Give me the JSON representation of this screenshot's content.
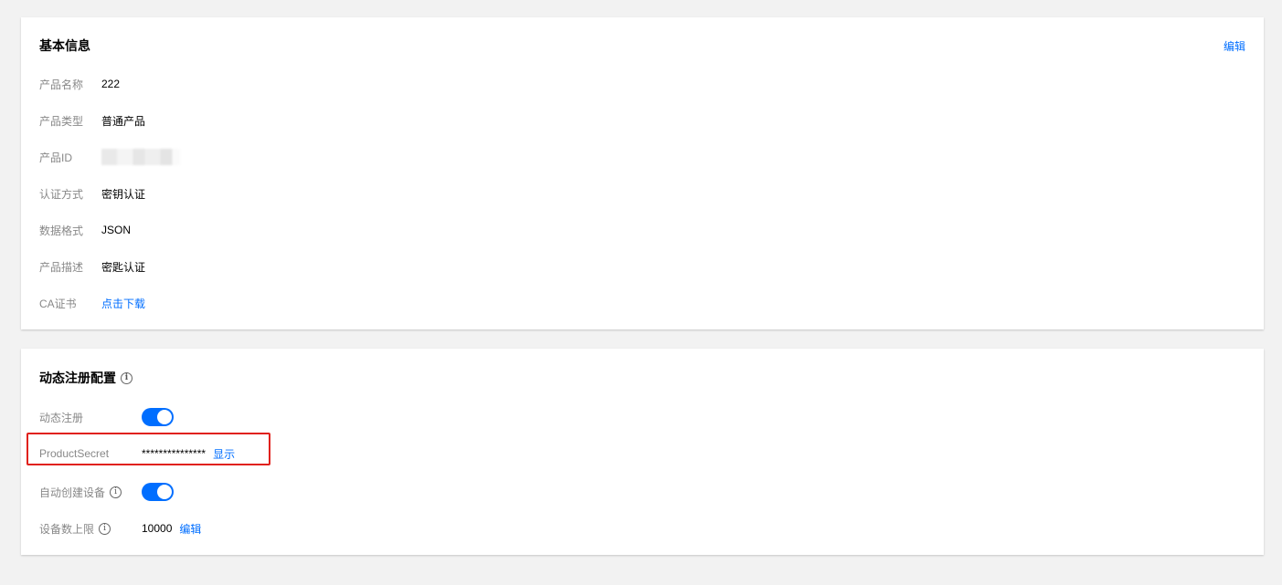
{
  "basic_info": {
    "title": "基本信息",
    "edit_label": "编辑",
    "fields": [
      {
        "label": "产品名称",
        "value": "222"
      },
      {
        "label": "产品类型",
        "value": "普通产品"
      },
      {
        "label": "产品ID",
        "value": ""
      },
      {
        "label": "认证方式",
        "value": "密钥认证"
      },
      {
        "label": "数据格式",
        "value": "JSON"
      },
      {
        "label": "产品描述",
        "value": "密匙认证"
      },
      {
        "label": "CA证书",
        "value": "点击下载"
      }
    ]
  },
  "dynamic_reg": {
    "title": "动态注册配置",
    "info_icon": "info-icon",
    "dynamic_register_label": "动态注册",
    "dynamic_register_enabled": true,
    "product_secret_label": "ProductSecret",
    "product_secret_masked": "***************",
    "show_label": "显示",
    "auto_create_label": "自动创建设备",
    "auto_create_enabled": true,
    "device_limit_label": "设备数上限",
    "device_limit_value": "10000",
    "device_limit_edit": "编辑"
  },
  "colors": {
    "accent": "#006eff",
    "highlight": "#e0211b",
    "background": "#f2f2f2"
  }
}
